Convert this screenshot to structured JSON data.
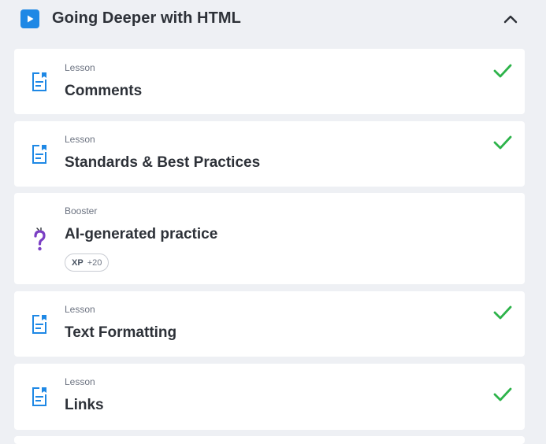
{
  "section": {
    "title": "Going Deeper with HTML"
  },
  "items": [
    {
      "type": "Lesson",
      "title": "Comments",
      "completed": true
    },
    {
      "type": "Lesson",
      "title": "Standards & Best Practices",
      "completed": true
    },
    {
      "type": "Booster",
      "title": "AI-generated practice",
      "completed": false,
      "xp_label": "XP",
      "xp_value": "+20"
    },
    {
      "type": "Lesson",
      "title": "Text Formatting",
      "completed": true
    },
    {
      "type": "Lesson",
      "title": "Links",
      "completed": true
    }
  ],
  "colors": {
    "accent": "#1e88e5",
    "check": "#2db34a",
    "booster": "#7b3fc4",
    "background": "#eef0f4"
  }
}
